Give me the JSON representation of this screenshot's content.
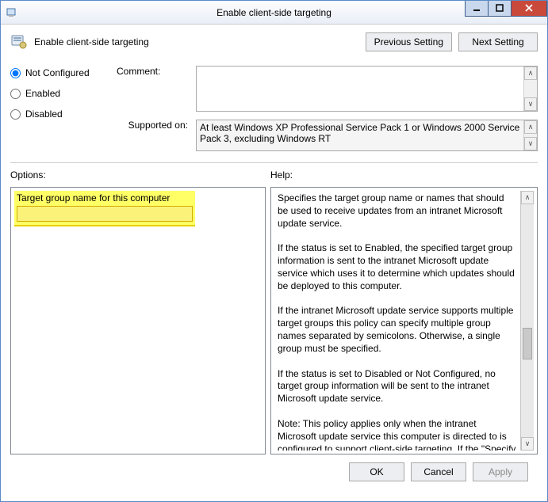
{
  "window": {
    "title": "Enable client-side targeting",
    "policy_name": "Enable client-side targeting"
  },
  "nav": {
    "prev": "Previous Setting",
    "next": "Next Setting"
  },
  "state": {
    "not_configured": "Not Configured",
    "enabled": "Enabled",
    "disabled": "Disabled"
  },
  "labels": {
    "comment": "Comment:",
    "supported_on": "Supported on:",
    "options": "Options:",
    "help": "Help:"
  },
  "values": {
    "comment": "",
    "supported_on": "At least Windows XP Professional Service Pack 1 or Windows 2000 Service Pack 3, excluding Windows RT",
    "target_group_label": "Target group name for this computer",
    "target_group_value": ""
  },
  "help_text": "Specifies the target group name or names that should be used to receive updates from an intranet Microsoft update service.\n\nIf the status is set to Enabled, the specified target group information is sent to the intranet Microsoft update service which uses it to determine which updates should be deployed to this computer.\n\nIf the intranet Microsoft update service supports multiple target groups this policy can specify multiple group names separated by semicolons. Otherwise, a single group must be specified.\n\nIf the status is set to Disabled or Not Configured, no target group information will be sent to the intranet Microsoft update service.\n\nNote: This policy applies only when the intranet Microsoft update service this computer is directed to is configured to support client-side targeting. If the \"Specify intranet Microsoft update service location\" policy is disabled or not configured, this policy has no effect.\nNote: This policy is not supported on Windows RT. Setting this",
  "buttons": {
    "ok": "OK",
    "cancel": "Cancel",
    "apply": "Apply"
  }
}
